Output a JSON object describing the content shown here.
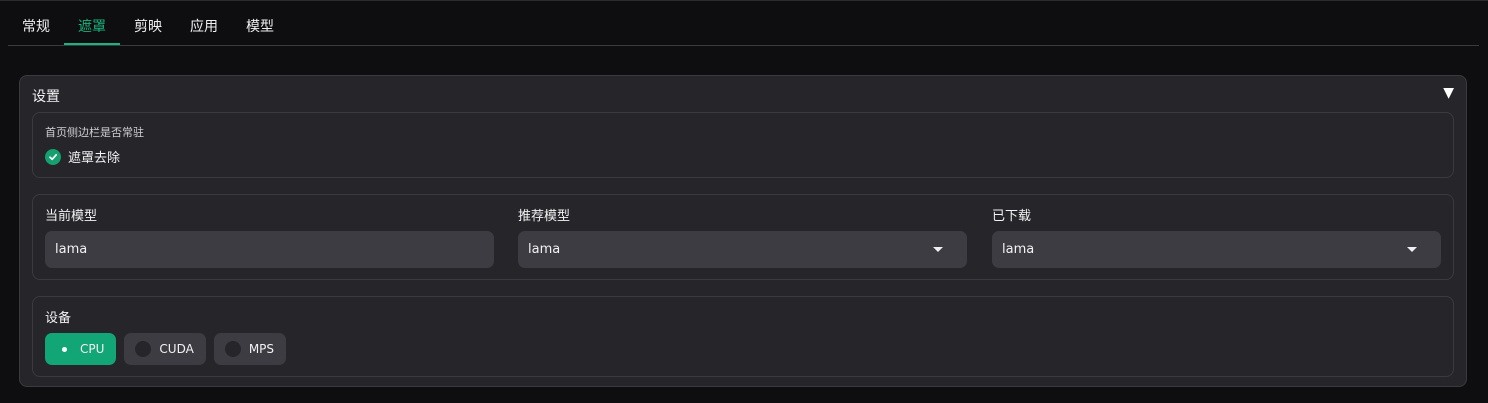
{
  "tabs": [
    {
      "label": "常规"
    },
    {
      "label": "遮罩"
    },
    {
      "label": "剪映"
    },
    {
      "label": "应用"
    },
    {
      "label": "模型"
    }
  ],
  "active_tab": "遮罩",
  "panel": {
    "title": "设置",
    "toggle_glyph": "▼"
  },
  "sidebar_setting": {
    "label": "首页侧边栏是否常驻",
    "checked_option": "遮罩去除"
  },
  "model": {
    "current_label": "当前模型",
    "current_value": "lama",
    "recommended_label": "推荐模型",
    "recommended_value": "lama",
    "downloaded_label": "已下载",
    "downloaded_value": "lama"
  },
  "device": {
    "label": "设备",
    "options": [
      "CPU",
      "CUDA",
      "MPS"
    ],
    "selected": "CPU"
  },
  "colors": {
    "accent": "#19b37d",
    "background": "#0e0e10",
    "panel": "#26262a",
    "input": "#3c3c42"
  }
}
